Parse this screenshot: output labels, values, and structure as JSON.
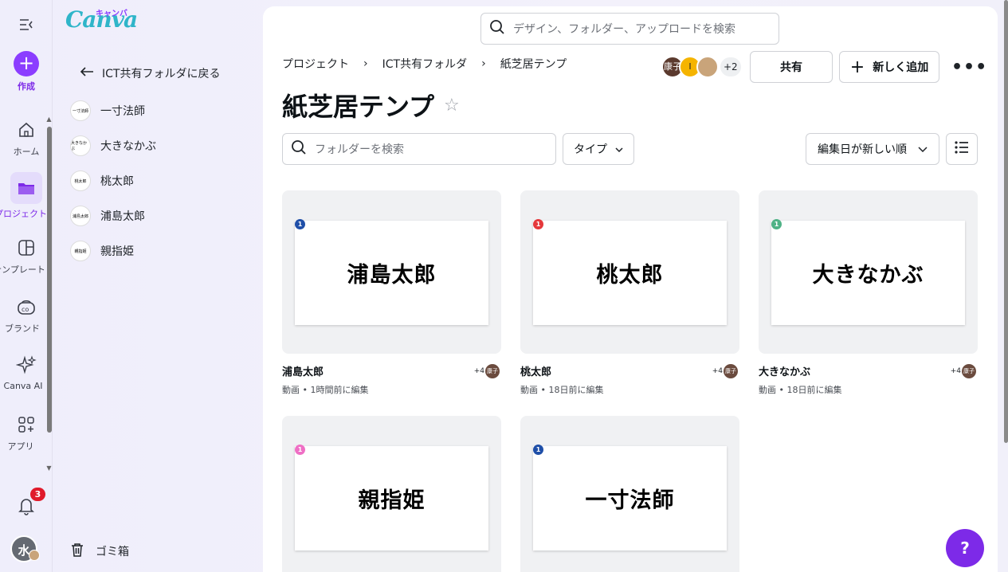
{
  "rail": {
    "create": "作成",
    "home": "ホーム",
    "projects": "プロジェクト",
    "templates": "テンプレート",
    "brand": "ブランド",
    "canva_ai": "Canva AI",
    "apps": "アプリ",
    "notifications_count": "3",
    "user_initial": "水"
  },
  "logo": {
    "text": "Canva",
    "kana": "キャンバ"
  },
  "folder_panel": {
    "back_label": "ICT共有フォルダに戻る",
    "items": [
      {
        "label": "一寸法師",
        "thumb": "一寸法師"
      },
      {
        "label": "大きなかぶ",
        "thumb": "大きなかぶ"
      },
      {
        "label": "桃太郎",
        "thumb": "桃太郎"
      },
      {
        "label": "浦島太郎",
        "thumb": "浦島太郎"
      },
      {
        "label": "親指姫",
        "thumb": "親指姫"
      }
    ],
    "trash_label": "ゴミ箱"
  },
  "header": {
    "search_placeholder": "デザイン、フォルダー、アップロードを検索",
    "breadcrumb": [
      "プロジェクト",
      "ICT共有フォルダ",
      "紙芝居テンプ"
    ],
    "title": "紙芝居テンプ",
    "collaborators": [
      {
        "initials": "康子",
        "color": "#5b3a2e"
      },
      {
        "initials": "I",
        "color": "#f5b400"
      },
      {
        "initials": "",
        "color": "#c9a47a"
      }
    ],
    "collaborators_more": "+2",
    "share_label": "共有",
    "add_new_label": "新しく追加"
  },
  "toolbar": {
    "folder_search_placeholder": "フォルダーを検索",
    "type_filter": "タイプ",
    "sort": "編集日が新しい順"
  },
  "designs": [
    {
      "title": "浦島太郎",
      "slide_text": "浦島太郎",
      "meta": "動画 • 1時間前に編集",
      "pin": "1",
      "pin_color": "#1f4fa8",
      "share_count": "+4",
      "share_avatar": "康子"
    },
    {
      "title": "桃太郎",
      "slide_text": "桃太郎",
      "meta": "動画 • 18日前に編集",
      "pin": "1",
      "pin_color": "#e5383b",
      "share_count": "+4",
      "share_avatar": "康子"
    },
    {
      "title": "大きなかぶ",
      "slide_text": "大きなかぶ",
      "meta": "動画 • 18日前に編集",
      "pin": "1",
      "pin_color": "#4fb286",
      "share_count": "+4",
      "share_avatar": "康子"
    },
    {
      "title": "親指姫",
      "slide_text": "親指姫",
      "meta": "",
      "pin": "1",
      "pin_color": "#ef6fc5",
      "share_count": "",
      "share_avatar": ""
    },
    {
      "title": "一寸法師",
      "slide_text": "一寸法師",
      "meta": "",
      "pin": "1",
      "pin_color": "#1f4fa8",
      "share_count": "",
      "share_avatar": ""
    }
  ],
  "help_label": "?"
}
